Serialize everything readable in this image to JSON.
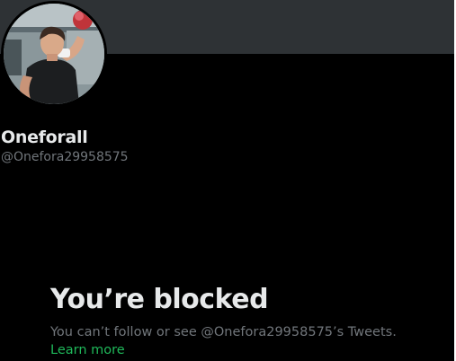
{
  "profile": {
    "display_name": "Oneforall",
    "handle": "@Onefora29958575"
  },
  "blocked": {
    "title": "You’re blocked",
    "description": "You can’t follow or see @Onefora29958575’s Tweets.",
    "learn_more": "Learn more"
  },
  "colors": {
    "background": "#000000",
    "banner": "#2e3235",
    "primary_text": "#e7e9ea",
    "secondary_text": "#71767b",
    "link": "#1fb85a"
  }
}
